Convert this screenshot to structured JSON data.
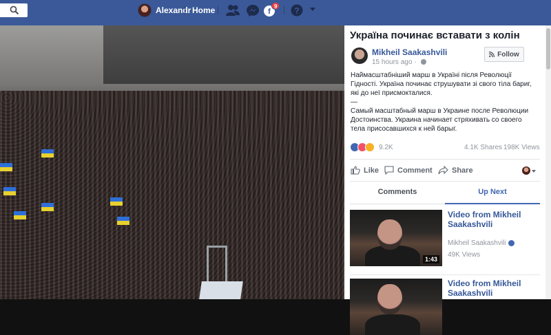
{
  "topbar": {
    "user_name": "Alexandr",
    "home_label": "Home",
    "notifications_count": "9"
  },
  "post": {
    "title": "Україна починає вставати з колін",
    "author": "Mikheil Saakashvili",
    "time": "15 hours ago · ",
    "follow_label": "Follow",
    "desc_ua": "Наймасштабніший марш в Україні після Революції Гідності. Україна починає струшувати зі свого тіла бариг, які до неї присмокталися.",
    "desc_sep": "—",
    "desc_ru": "Самый масштабный марш в Украине после Революции Достоинства. Украина начинает стряхивать со своего тела присосавшихся к ней барыг.",
    "reactions_count": "9.2K",
    "shares": "4.1K Shares",
    "views": "198K Views"
  },
  "actions": {
    "like": "Like",
    "comment": "Comment",
    "share": "Share"
  },
  "tabs": {
    "comments": "Comments",
    "up_next": "Up Next"
  },
  "up_next": [
    {
      "title": "Video from Mikheil Saakashvili",
      "author": "Mikheil Saakashvili",
      "views": "49K Views",
      "duration": "1:43"
    },
    {
      "title": "Video from Mikheil Saakashvili"
    }
  ],
  "colors": {
    "brand": "#3b5998",
    "link": "#365899",
    "tab_active": "#4267b2"
  }
}
